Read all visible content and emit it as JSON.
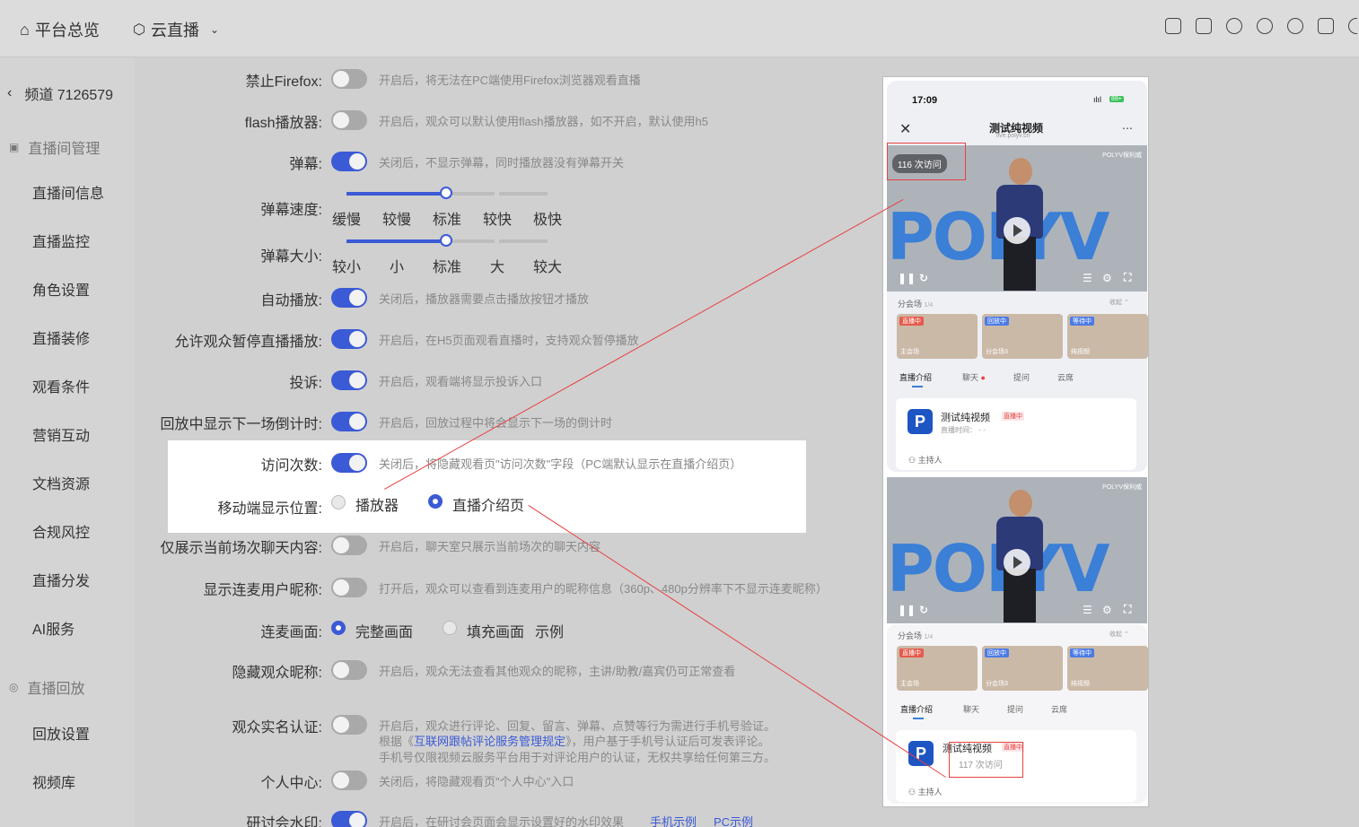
{
  "topbar": {
    "home_label": "平台总览",
    "live_label": "云直播",
    "icons": [
      "clipboard-icon",
      "download-icon",
      "bell-icon",
      "yuan-icon",
      "help-icon",
      "screen-icon",
      "globe-icon"
    ]
  },
  "sidebar": {
    "channel": "频道 7126579",
    "group1": "直播间管理",
    "items1": [
      "直播间信息",
      "直播监控",
      "角色设置",
      "直播装修",
      "观看条件",
      "营销互动",
      "文档资源",
      "合规风控",
      "直播分发",
      "AI服务"
    ],
    "group2": "直播回放",
    "items2": [
      "回放设置",
      "视频库"
    ]
  },
  "settings": [
    {
      "label": "禁止Firefox:",
      "on": false,
      "desc": "开启后，将无法在PC端使用Firefox浏览器观看直播"
    },
    {
      "label": "flash播放器:",
      "on": false,
      "desc": "开启后，观众可以默认使用flash播放器，如不开启，默认使用h5"
    },
    {
      "label": "弹幕:",
      "on": true,
      "desc": "关闭后，不显示弹幕，同时播放器没有弹幕开关"
    },
    {
      "label": "自动播放:",
      "on": true,
      "desc": "关闭后，播放器需要点击播放按钮才播放"
    },
    {
      "label": "允许观众暂停直播播放:",
      "on": true,
      "desc": "开启后，在H5页面观看直播时，支持观众暂停播放"
    },
    {
      "label": "投诉:",
      "on": true,
      "desc": "开启后，观看端将显示投诉入口"
    },
    {
      "label": "回放中显示下一场倒计时:",
      "on": true,
      "desc": "开启后，回放过程中将会显示下一场的倒计时"
    },
    {
      "label": "访问次数:",
      "on": true,
      "desc": "关闭后，将隐藏观看页\"访问次数\"字段（PC端默认显示在直播介绍页）"
    },
    {
      "label": "仅展示当前场次聊天内容:",
      "on": false,
      "desc": "开启后，聊天室只展示当前场次的聊天内容"
    },
    {
      "label": "显示连麦用户昵称:",
      "on": false,
      "desc": "打开后，观众可以查看到连麦用户的昵称信息（360p、480p分辨率下不显示连麦昵称）"
    },
    {
      "label": "隐藏观众昵称:",
      "on": false,
      "desc": "开启后，观众无法查看其他观众的昵称，主讲/助教/嘉宾仍可正常查看"
    },
    {
      "label": "观众实名认证:",
      "on": false,
      "desc": "开启后，观众进行评论、回复、留言、弹幕、点赞等行为需进行手机号验证。"
    },
    {
      "label": "个人中心:",
      "on": false,
      "desc": "关闭后，将隐藏观看页\"个人中心\"入口"
    },
    {
      "label": "研讨会水印:",
      "on": true,
      "desc": "开启后，在研讨会页面会显示设置好的水印效果"
    }
  ],
  "realname_desc2_pre": "根据《",
  "realname_link": "互联网跟帖评论服务管理规定",
  "realname_desc2_post": "》，用户基于手机号认证后可发表评论。",
  "realname_desc3": "手机号仅限视频云服务平台用于对评论用户的认证，无权共享给任何第三方。",
  "watermark_links": [
    "手机示例",
    "PC示例"
  ],
  "danmu_speed": {
    "label": "弹幕速度:",
    "ticks": [
      "缓慢",
      "较慢",
      "标准",
      "较快",
      "极快"
    ],
    "value_index": 2
  },
  "danmu_size": {
    "label": "弹幕大小:",
    "ticks": [
      "较小",
      "小",
      "标准",
      "大",
      "较大"
    ],
    "value_index": 2
  },
  "mobile_pos": {
    "label": "移动端显示位置:",
    "options": [
      "播放器",
      "直播介绍页"
    ],
    "selected": 1
  },
  "lianmai": {
    "label": "连麦画面:",
    "options": [
      "完整画面",
      "填充画面"
    ],
    "selected": 0,
    "example": "示例"
  },
  "phone": {
    "time": "17:09",
    "battery": "89+",
    "title": "测试纯视频",
    "url": "live.polyv.cn",
    "visit1": "116 次访问",
    "visit2": "117 次访问",
    "brand": "POLYV保利威",
    "logo_text": "POLYV",
    "sessions_label": "分会场",
    "sessions_count": "1/4",
    "collapse": "收起",
    "thumbs": [
      {
        "tag": "直播中",
        "name": "主会场",
        "color": "#e65a4c"
      },
      {
        "tag": "回放中",
        "name": "分会场3",
        "color": "#4c7be6"
      },
      {
        "tag": "等待中",
        "name": "纯视频",
        "color": "#4c7be6"
      }
    ],
    "tabs": [
      "直播介绍",
      "聊天",
      "提问",
      "云席"
    ],
    "card_title": "测试纯视频",
    "card_status": "直播中",
    "card_time": "直播时间： - -",
    "host": "主持人"
  }
}
